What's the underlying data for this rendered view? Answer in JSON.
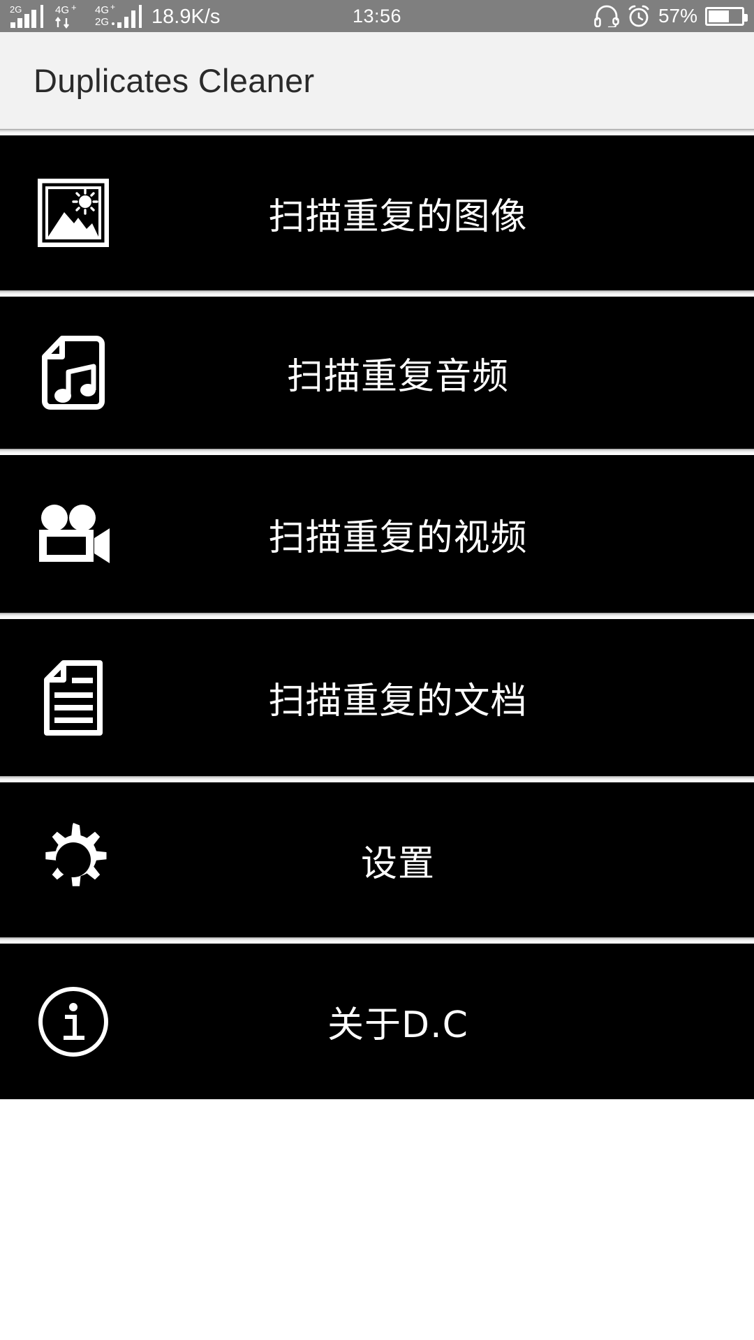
{
  "status_bar": {
    "network_badges": [
      "2G",
      "4G+",
      "4G+",
      "2G"
    ],
    "network_speed": "18.9K/s",
    "time": "13:56",
    "headphone_icon": "headphone-icon",
    "alarm_icon": "alarm-clock-icon",
    "battery_percent": "57%",
    "battery_level": 57,
    "background_color": "#7f7f7f",
    "foreground_color": "#ffffff"
  },
  "header": {
    "title": "Duplicates Cleaner",
    "background_color": "#f2f2f2",
    "text_color": "#2a2a2a"
  },
  "menu": {
    "card_background": "#000000",
    "card_text_color": "#ffffff",
    "items": [
      {
        "id": "scan-duplicate-images",
        "label": "扫描重复的图像",
        "icon": "picture-icon"
      },
      {
        "id": "scan-duplicate-audio",
        "label": "扫描重复音频",
        "icon": "audio-file-icon"
      },
      {
        "id": "scan-duplicate-videos",
        "label": "扫描重复的视频",
        "icon": "video-camera-icon"
      },
      {
        "id": "scan-duplicate-documents",
        "label": "扫描重复的文档",
        "icon": "document-icon"
      },
      {
        "id": "settings",
        "label": "设置",
        "icon": "gear-icon"
      },
      {
        "id": "about-dc",
        "label": "关于D.C",
        "icon": "info-circle-icon"
      }
    ]
  }
}
